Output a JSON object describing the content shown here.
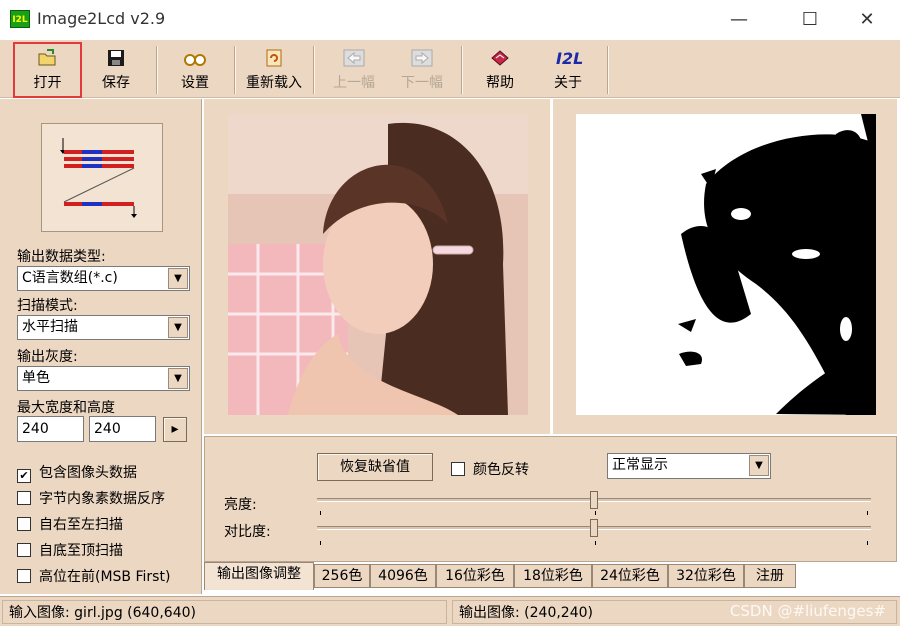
{
  "window": {
    "icon_label": "I2L",
    "title": "Image2Lcd v2.9",
    "minimize": "—",
    "maximize": "☐",
    "close": "✕"
  },
  "toolbar": {
    "open": "打开",
    "save": "保存",
    "settings": "设置",
    "reload": "重新载入",
    "prev": "上一幅",
    "next": "下一幅",
    "help": "帮助",
    "about": "关于",
    "about_icon_text": "I2L"
  },
  "left": {
    "output_type_label": "输出数据类型:",
    "output_type_value": "C语言数组(*.c)",
    "scan_mode_label": "扫描模式:",
    "scan_mode_value": "水平扫描",
    "gray_label": "输出灰度:",
    "gray_value": "单色",
    "size_label": "最大宽度和高度",
    "width_value": "240",
    "height_value": "240",
    "size_btn": "▸",
    "options": [
      {
        "label": "包含图像头数据",
        "checked": true
      },
      {
        "label": "字节内象素数据反序",
        "checked": false
      },
      {
        "label": "自右至左扫描",
        "checked": false
      },
      {
        "label": "自底至顶扫描",
        "checked": false
      },
      {
        "label": "高位在前(MSB First)",
        "checked": false
      }
    ]
  },
  "adjust": {
    "restore_btn": "恢复缺省值",
    "invert_label": "颜色反转",
    "invert_checked": false,
    "display_mode": "正常显示",
    "brightness_label": "亮度:",
    "brightness_level": 0.5,
    "contrast_label": "对比度:",
    "contrast_level": 0.5
  },
  "tabs": [
    {
      "label": "输出图像调整",
      "active": true
    },
    {
      "label": "256色",
      "active": false
    },
    {
      "label": "4096色",
      "active": false
    },
    {
      "label": "16位彩色",
      "active": false
    },
    {
      "label": "18位彩色",
      "active": false
    },
    {
      "label": "24位彩色",
      "active": false
    },
    {
      "label": "32位彩色",
      "active": false
    },
    {
      "label": "注册",
      "active": false
    }
  ],
  "status": {
    "input": "输入图像: girl.jpg (640,640)",
    "output": "输出图像: (240,240)",
    "watermark": "CSDN @#liufenges#"
  },
  "colors": {
    "panel_bg": "#ecd7c2",
    "highlight": "#e23a3a"
  }
}
